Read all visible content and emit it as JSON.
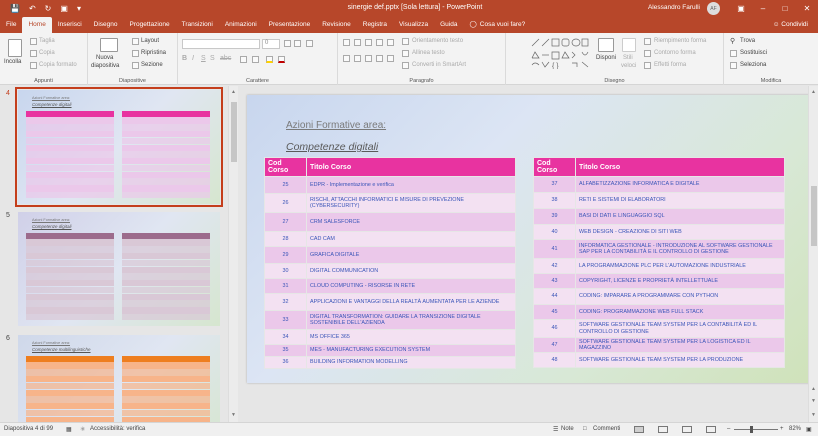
{
  "window": {
    "title": "sinergie def.pptx [Sola lettura]  -  PowerPoint",
    "user": "Alessandro Farulli",
    "initials": "AF"
  },
  "tabs": [
    "File",
    "Home",
    "Inserisci",
    "Disegno",
    "Progettazione",
    "Transizioni",
    "Animazioni",
    "Presentazione",
    "Revisione",
    "Registra",
    "Visualizza",
    "Guida"
  ],
  "tell_me": "Cosa vuoi fare?",
  "share": "Condividi",
  "ribbon": {
    "appunti": {
      "label": "Appunti",
      "paste": "Incolla",
      "cut": "Taglia",
      "copy": "Copia",
      "format_painter": "Copia formato"
    },
    "diapositive": {
      "label": "Diapositive",
      "new_slide": "Nuova",
      "new_slide2": "diapositiva",
      "layout": "Layout",
      "reset": "Ripristina",
      "section": "Sezione"
    },
    "carattere": {
      "label": "Carattere",
      "font_size": "0"
    },
    "paragrafo": {
      "label": "Paragrafo",
      "direction": "Orientamento testo",
      "align": "Allinea testo",
      "smartart": "Converti in SmartArt"
    },
    "disegno": {
      "label": "Disegno",
      "arrange": "Disponi",
      "quick_styles": "Stili",
      "quick_styles2": "veloci",
      "fill": "Riempimento forma",
      "outline": "Contorno forma",
      "effects": "Effetti forma"
    },
    "modifica": {
      "label": "Modifica",
      "find": "Trova",
      "replace": "Sostituisci",
      "select": "Seleziona"
    }
  },
  "thumbnails": [
    {
      "number": "4",
      "title": "Azioni Formative area:",
      "subtitle": "Competenze digitali",
      "header_color": "#e833a0",
      "row_color": "#ebc8ea",
      "background": "#c8d6ee"
    },
    {
      "number": "5",
      "title": "Azioni Formative area:",
      "subtitle": "Competenze digitali",
      "header_color": "#9c6b8c",
      "row_color": "#d9c8d6",
      "background": "#d0d0e8"
    },
    {
      "number": "6",
      "title": "Azioni Formative area:",
      "subtitle": "Competenze multilinguistiche",
      "header_color": "#ee7e1f",
      "row_color": "#f7b48a",
      "background": "#cfd8ea"
    }
  ],
  "slide": {
    "title": "Azioni Formative area:",
    "subtitle": "Competenze digitali",
    "col_code": "Cod Corso",
    "col_title": "Titolo Corso",
    "left_table": [
      {
        "code": "25",
        "title": "EDPR - Implementazione e verifica"
      },
      {
        "code": "26",
        "title": "RISCHI, ATTACCHI INFORMATICI E MISURE DI PREVEZIONE (CYBERSECURITY)"
      },
      {
        "code": "27",
        "title": "CRM SALESFORCE"
      },
      {
        "code": "28",
        "title": "CAD CAM"
      },
      {
        "code": "29",
        "title": "GRAFICA DIGITALE"
      },
      {
        "code": "30",
        "title": "DIGITAL COMMUNICATION"
      },
      {
        "code": "31",
        "title": "CLOUD COMPUTING - RISORSE IN RETE"
      },
      {
        "code": "32",
        "title": "APPLICAZIONI E VANTAGGI DELLA REALTÀ AUMENTATA PER LE AZIENDE"
      },
      {
        "code": "33",
        "title": "DIGITAL TRANSFORMATION: GUIDARE LA TRANSIZIONE DIGITALE SOSTENIBILE DELL'AZIENDA"
      },
      {
        "code": "34",
        "title": "MS OFFICE 365"
      },
      {
        "code": "35",
        "title": "MES - MANUFACTURING EXECUTION SYSTEM"
      },
      {
        "code": "36",
        "title": "BUILDING INFORMATION MODELLING"
      }
    ],
    "right_table": [
      {
        "code": "37",
        "title": "ALFABETIZZAZIONE INFORMATICA E DIGITALE"
      },
      {
        "code": "38",
        "title": "RETI E SISTEMI DI ELABORATORI"
      },
      {
        "code": "39",
        "title": "BASI DI DATI E LINGUAGGIO SQL"
      },
      {
        "code": "40",
        "title": "WEB DESIGN - CREAZIONE DI SITI WEB"
      },
      {
        "code": "41",
        "title": "INFORMATICA GESTIONALE - INTRODUZIONE AL SOFTWARE GESTIONALE SAP PER LA CONTABILITÀ E IL CONTROLLO DI GESTIONE"
      },
      {
        "code": "42",
        "title": "LA PROGRAMMAZIONE PLC PER L'AUTOMAZIONE INDUSTRIALE"
      },
      {
        "code": "43",
        "title": "COPYRIGHT, LICENZE E PROPRIETÀ INTELLETTUALE"
      },
      {
        "code": "44",
        "title": "CODING: IMPARARE A PROGRAMMARE CON PYTHON"
      },
      {
        "code": "45",
        "title": "CODING: PROGRAMMAZIONE WEB FULL STACK"
      },
      {
        "code": "46",
        "title": "SOFTWARE GESTIONALE TEAM SYSTEM PER LA CONTABILITÀ ED IL CONTROLLO DI GESTIONE"
      },
      {
        "code": "47",
        "title": "SOFTWARE GESTIONALE TEAM SYSTEM PER LA LOGISTICA ED IL MAGAZZINO"
      },
      {
        "code": "48",
        "title": "SOFTWARE GESTIONALE TEAM SYSTEM PER LA PRODUZIONE"
      }
    ]
  },
  "status": {
    "slide_info": "Diapositiva 4 di 99",
    "accessibility": "Accessibilità: verifica",
    "notes": "Note",
    "comments": "Commenti",
    "zoom": "82%",
    "zoom_percent": 82
  },
  "colors": {
    "accent": "#b7472a",
    "header_pink": "#e833a0",
    "selection": "#c43e1c"
  }
}
